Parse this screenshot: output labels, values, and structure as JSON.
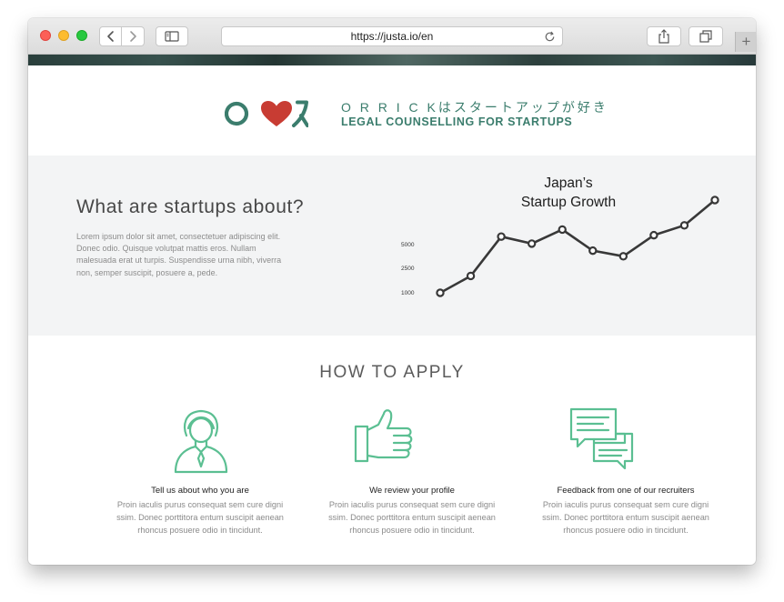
{
  "browser": {
    "url": "https://justa.io/en",
    "icons": {
      "back": "chevron-left-icon",
      "forward": "chevron-right-icon",
      "sidebar": "sidebar-icon",
      "reload": "reload-icon",
      "share": "share-icon",
      "tabs": "tabs-icon",
      "new_tab": "plus-icon"
    }
  },
  "brand": {
    "line1": "O R R I C Kはスタートアップが好き",
    "line2": "LEGAL COUNSELLING FOR STARTUPS",
    "color": "#3b7d6d",
    "heart_color": "#c83c33"
  },
  "startups": {
    "heading": "What are startups about?",
    "body": "Lorem ipsum dolor sit amet, consectetuer adipiscing elit. Donec odio. Quisque volutpat mattis eros. Nullam malesuada erat ut turpis. Suspendisse urna nibh, viverra non, semper suscipit, posuere a, pede."
  },
  "chart_data": {
    "type": "line",
    "title_line1": "Japan’s",
    "title_line2": "Startup Growth",
    "y_tick_labels": [
      "5000",
      "2500",
      "1000"
    ],
    "values": [
      1000,
      2200,
      5000,
      4500,
      5500,
      4000,
      3600,
      5100,
      5800,
      7600
    ],
    "line_color": "#383838"
  },
  "apply": {
    "title": "HOW TO APPLY",
    "accent_color": "#5bbf92",
    "steps": [
      {
        "icon": "person-icon",
        "title": "Tell us about who you are",
        "text": "Proin iaculis purus consequat sem cure digni ssim. Donec porttitora entum suscipit aenean rhoncus posuere odio in tincidunt."
      },
      {
        "icon": "thumbs-up-icon",
        "title": "We review your profile",
        "text": "Proin iaculis purus consequat sem cure digni ssim. Donec porttitora entum suscipit aenean rhoncus posuere odio in tincidunt."
      },
      {
        "icon": "chat-bubbles-icon",
        "title": "Feedback from one of our recruiters",
        "text": "Proin iaculis purus consequat sem cure digni ssim. Donec porttitora entum suscipit aenean rhoncus posuere odio in tincidunt."
      }
    ]
  }
}
